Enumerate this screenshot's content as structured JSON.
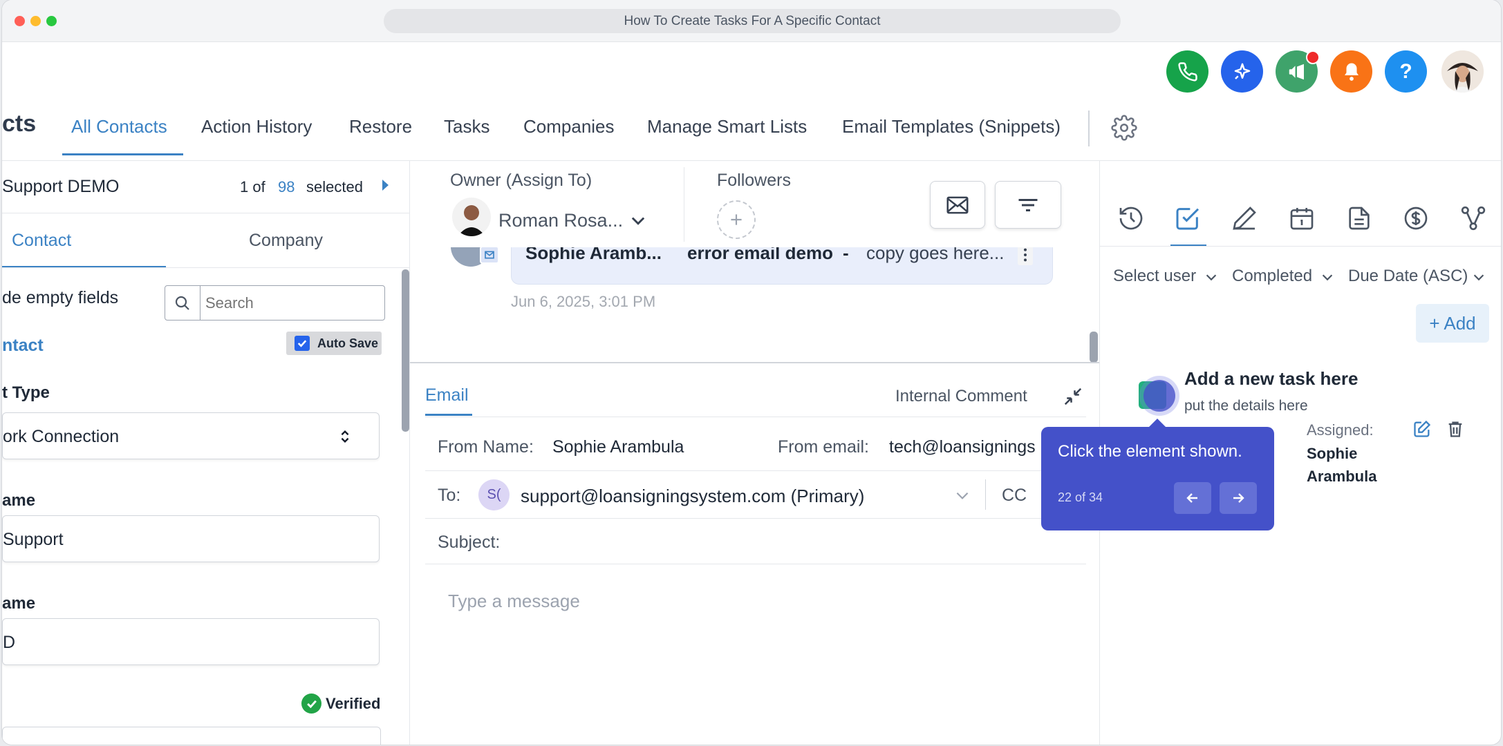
{
  "window": {
    "url_title": "How To Create Tasks For A Specific Contact"
  },
  "header_icons": [
    "phone-icon",
    "sparkle-icon",
    "megaphone-icon",
    "bell-icon",
    "help-icon"
  ],
  "nav": {
    "title_fragment": "cts",
    "tabs": [
      "All Contacts",
      "Action History",
      "Restore",
      "Tasks",
      "Companies",
      "Manage Smart Lists",
      "Email Templates (Snippets)"
    ],
    "active_tab": "All Contacts"
  },
  "left_panel": {
    "contact_name": "Support DEMO",
    "selection_prefix": "1 of",
    "selection_count": "98",
    "selection_suffix": "selected",
    "tabs": [
      "Contact",
      "Company"
    ],
    "hide_empty_label": "de empty fields",
    "search_placeholder": "Search",
    "section_title": "ntact",
    "auto_save_label": "Auto Save",
    "fields": [
      {
        "label": "t Type",
        "value": "ork Connection"
      },
      {
        "label": "ame",
        "value": "Support"
      },
      {
        "label": "ame",
        "value": "D"
      }
    ],
    "verified_label": "Verified"
  },
  "owner": {
    "label": "Owner (Assign To)",
    "name": "Roman Rosa...",
    "followers_label": "Followers"
  },
  "conversation": {
    "sender": "Sophie Aramb...",
    "subject": "error email demo",
    "separator": "-",
    "preview": "copy goes here...",
    "timestamp": "Jun 6, 2025, 3:01 PM"
  },
  "composer": {
    "tab_email": "Email",
    "tab_internal": "Internal Comment",
    "from_name_label": "From Name:",
    "from_name_value": "Sophie Arambula",
    "from_email_label": "From email:",
    "from_email_value": "tech@loansignings",
    "to_label": "To:",
    "to_avatar": "S(",
    "to_value": "support@loansigningsystem.com (Primary)",
    "cc_label": "CC",
    "subject_label": "Subject:",
    "message_placeholder": "Type a message"
  },
  "tasks_panel": {
    "filters": [
      "Select user",
      "Completed",
      "Due Date (ASC)"
    ],
    "add_label": "+ Add",
    "task": {
      "title": "Add a new task here",
      "details": "put the details here",
      "assigned_label": "Assigned:",
      "assignee_first": "Sophie",
      "assignee_last": "Arambula"
    }
  },
  "tooltip": {
    "text": "Click the element shown.",
    "step": "22 of 34"
  },
  "colors": {
    "accent": "#3b82c4",
    "phone": "#16a34a",
    "sparkle": "#2563eb",
    "megaphone": "#3fa36b",
    "bell": "#f97316",
    "help": "#1e90f0",
    "tooltip": "#4451c9"
  }
}
